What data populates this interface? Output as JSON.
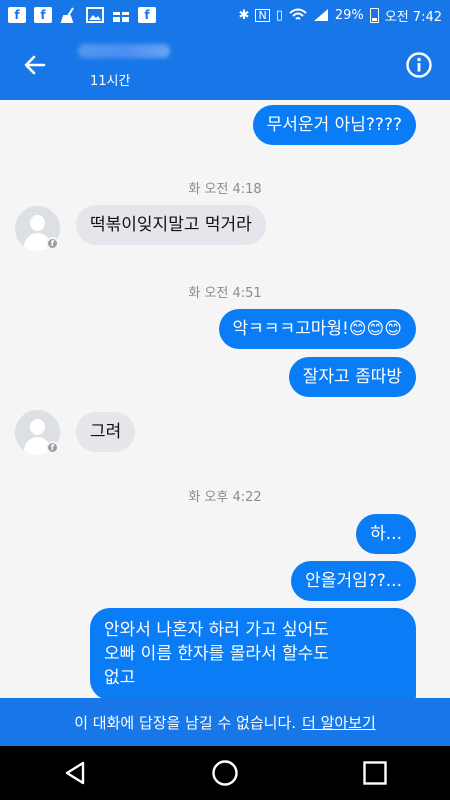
{
  "status_bar": {
    "left_icons": [
      "facebook-icon",
      "facebook-icon",
      "broom-icon",
      "image-icon",
      "gift-icon",
      "facebook-icon"
    ],
    "right_icons": [
      "bluetooth-icon",
      "nfc-icon",
      "vibrate-icon",
      "wifi-icon",
      "signal-icon"
    ],
    "battery_text": "29%",
    "time": "오전 7:42"
  },
  "header": {
    "active_time": "11시간",
    "back_icon": "back-arrow-icon",
    "info_icon": "info-icon"
  },
  "messages": [
    {
      "type": "out",
      "text": "무서운거 아님????"
    },
    {
      "type": "timestamp",
      "text": "화 오전 4:18"
    },
    {
      "type": "in",
      "text": "떡볶이잊지말고 먹거라"
    },
    {
      "type": "timestamp",
      "text": "화 오전 4:51"
    },
    {
      "type": "out",
      "text": "악ㅋㅋㅋ고마웡!😊😊😊"
    },
    {
      "type": "out",
      "text": "잘자고 좀따방"
    },
    {
      "type": "in",
      "text": "그려"
    },
    {
      "type": "timestamp",
      "text": "화 오후 4:22"
    },
    {
      "type": "out",
      "text": "하..."
    },
    {
      "type": "out",
      "text": "안올거임??..."
    },
    {
      "type": "out",
      "lines": [
        "안와서 나혼자 하러 가고 싶어도",
        "오빠 이름 한자를 몰라서 할수도",
        "없고"
      ]
    }
  ],
  "banner": {
    "text": "이 대화에 답장을 남길 수 없습니다.",
    "link": "더 알아보기"
  },
  "colors": {
    "brand_blue": "#1877e8",
    "outgoing_bubble": "#0a7cf5",
    "incoming_bubble": "#e4e6eb",
    "timestamp_gray": "#8c8c8c"
  }
}
